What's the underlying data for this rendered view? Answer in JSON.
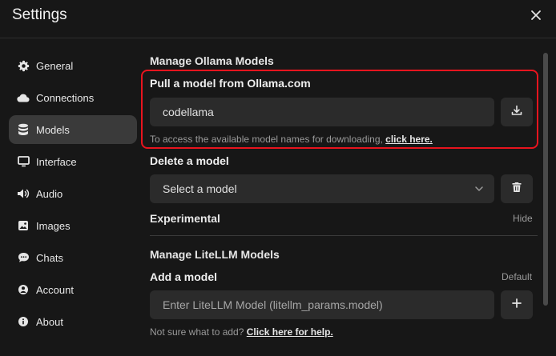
{
  "window": {
    "title": "Settings"
  },
  "sidebar": {
    "items": [
      {
        "label": "General",
        "icon": "gear-icon",
        "active": false
      },
      {
        "label": "Connections",
        "icon": "cloud-icon",
        "active": false
      },
      {
        "label": "Models",
        "icon": "database-icon",
        "active": true
      },
      {
        "label": "Interface",
        "icon": "monitor-icon",
        "active": false
      },
      {
        "label": "Audio",
        "icon": "speaker-icon",
        "active": false
      },
      {
        "label": "Images",
        "icon": "image-icon",
        "active": false
      },
      {
        "label": "Chats",
        "icon": "chat-bubble-icon",
        "active": false
      },
      {
        "label": "Account",
        "icon": "user-icon",
        "active": false
      },
      {
        "label": "About",
        "icon": "info-icon",
        "active": false
      }
    ]
  },
  "ollama": {
    "section_title": "Manage Ollama Models",
    "pull": {
      "label": "Pull a model from Ollama.com",
      "value": "codellama",
      "hint_text": "To access the available model names for downloading, ",
      "hint_link": "click here."
    },
    "delete": {
      "label": "Delete a model",
      "select_value": "Select a model"
    },
    "experimental": {
      "label": "Experimental",
      "toggle_label": "Hide"
    }
  },
  "litellm": {
    "section_title": "Manage LiteLLM Models",
    "add": {
      "label": "Add a model",
      "mode_label": "Default",
      "placeholder": "Enter LiteLLM Model (litellm_params.model)"
    },
    "help_text": "Not sure what to add? ",
    "help_link": "Click here for help."
  },
  "colors": {
    "background": "#171717",
    "field": "#2b2b2b",
    "active_nav": "#3a3a3a",
    "highlight": "#e8141e"
  }
}
